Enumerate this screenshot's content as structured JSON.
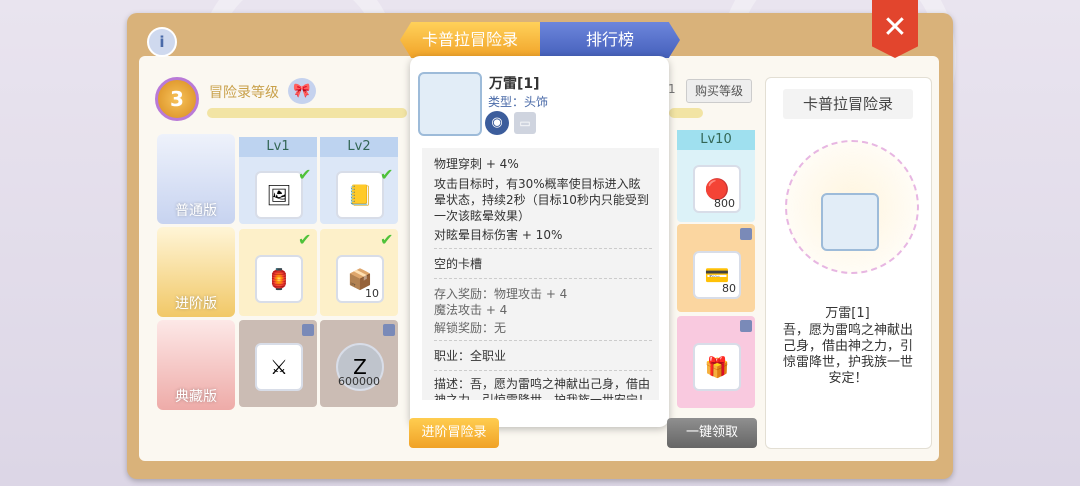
{
  "tabs": {
    "active": "卡普拉冒险录",
    "inactive": "排行榜"
  },
  "header": {
    "level": "3",
    "level_label": "冒险录等级",
    "buy_level": "购买等级",
    "pct_fragment": "1"
  },
  "info_icon": "i",
  "close_icon": "✕",
  "rows": [
    {
      "label": "普通版",
      "color": "#cdd7f0"
    },
    {
      "label": "进阶版",
      "color": "#f5d27c"
    },
    {
      "label": "典藏版",
      "color": "#f1b7b4"
    }
  ],
  "level_headers": {
    "lv1": "Lv1",
    "lv2": "Lv2",
    "lv10": "Lv10"
  },
  "grid": {
    "lv1_basic_item": "🖼",
    "lv2_basic_item": "📒",
    "lv1_adv_item": "🏮",
    "lv2_adv_item": "📦",
    "lv2_adv_qty": "10",
    "lv1_prem_item": "⚔",
    "lv2_prem_item": "Z",
    "lv2_prem_qty": "600000",
    "lv10_basic_item": "🔴",
    "lv10_basic_qty": "800",
    "lv10_adv_item": "💳",
    "lv10_adv_qty": "80",
    "lv10_prem_item": "🎁"
  },
  "tooltip": {
    "name": "万雷[1]",
    "type": "类型：头饰",
    "eye": "◉",
    "book": "▭",
    "stat1": "物理穿刺 + 4%",
    "stat2": "攻击目标时，有30%概率使目标进入眩晕状态，持续2秒（目标10秒内只能受到一次该眩晕效果）",
    "stat3": "对眩晕目标伤害 + 10%",
    "slot": "空的卡槽",
    "deposit": "存入奖励：物理攻击 + 4\n魔法攻击 + 4",
    "unlock": "解锁奖励：无",
    "job": "职业：全职业",
    "desc": "描述：吾，愿为雷鸣之神献出己身，借由神之力，引惊雷降世，护我族一世安宁！"
  },
  "side": {
    "title": "卡普拉冒险录",
    "item_name": "万雷[1]",
    "desc": "吾，愿为雷鸣之神献出己身，借由神之力，引惊雷降世，护我族一世安定！"
  },
  "buttons": {
    "advanced": "进阶冒险录",
    "collect_all": "一键领取"
  }
}
